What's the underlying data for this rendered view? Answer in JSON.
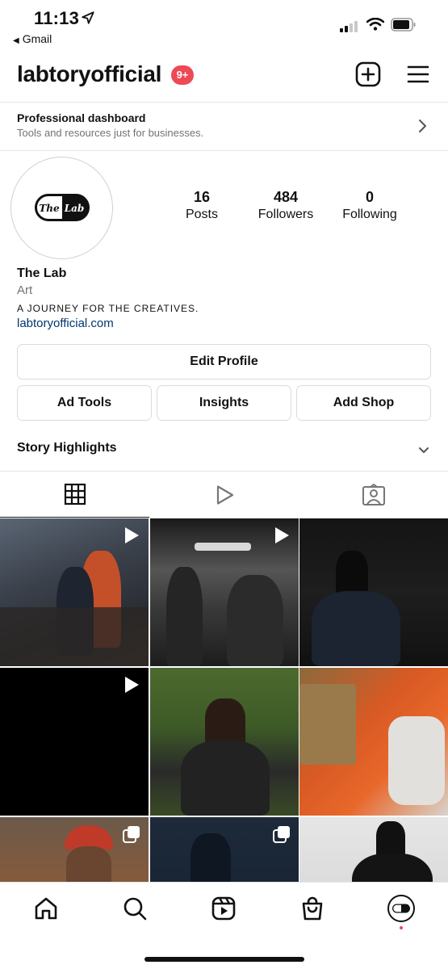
{
  "status_bar": {
    "time": "11:13",
    "back_app": "Gmail",
    "icons": [
      "location-arrow-icon",
      "signal-icon",
      "wifi-icon",
      "battery-icon"
    ]
  },
  "header": {
    "username": "labtoryofficial",
    "notification_badge": "9+",
    "badge_color": "#ed4956",
    "icons": [
      "new-post-icon",
      "menu-icon"
    ]
  },
  "dashboard": {
    "title": "Professional dashboard",
    "subtitle": "Tools and resources just for businesses."
  },
  "profile": {
    "avatar_logo_text": "The Lab",
    "stats": [
      {
        "value": "16",
        "label": "Posts"
      },
      {
        "value": "484",
        "label": "Followers"
      },
      {
        "value": "0",
        "label": "Following"
      }
    ],
    "name": "The Lab",
    "category": "Art",
    "bio": "A JOURNEY FOR THE CREATIVES.",
    "link": "labtoryofficial.com",
    "link_color": "#00376b"
  },
  "buttons": {
    "edit_profile": "Edit Profile",
    "ad_tools": "Ad Tools",
    "insights": "Insights",
    "add_shop": "Add Shop"
  },
  "highlights": {
    "title": "Story Highlights"
  },
  "tabs": [
    {
      "icon": "grid-icon",
      "active": true
    },
    {
      "icon": "reels-play-icon",
      "active": false
    },
    {
      "icon": "tagged-icon",
      "active": false
    }
  ],
  "posts": [
    {
      "type": "video",
      "icon": "play-icon"
    },
    {
      "type": "video",
      "icon": "play-icon"
    },
    {
      "type": "image",
      "icon": ""
    },
    {
      "type": "video",
      "icon": "play-icon"
    },
    {
      "type": "image",
      "icon": ""
    },
    {
      "type": "image",
      "icon": ""
    },
    {
      "type": "carousel",
      "icon": "carousel-icon"
    },
    {
      "type": "carousel",
      "icon": "carousel-icon"
    },
    {
      "type": "image",
      "icon": ""
    }
  ],
  "bottom_nav": [
    "home-icon",
    "search-icon",
    "reels-icon",
    "shop-icon",
    "profile-avatar"
  ]
}
